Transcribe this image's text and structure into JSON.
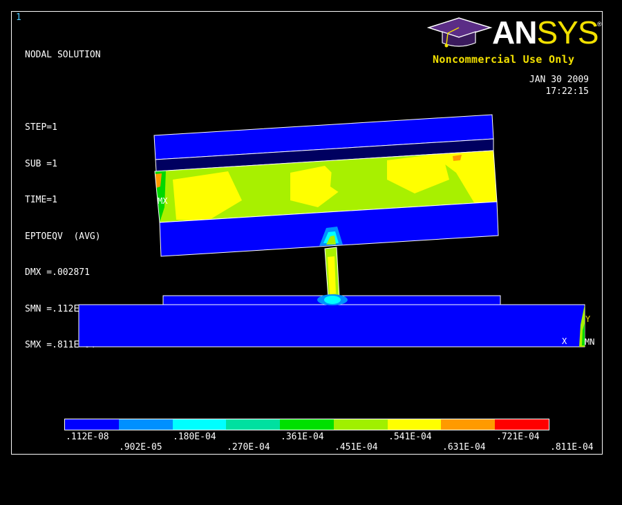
{
  "window_number": "1",
  "info_lines": [
    "NODAL SOLUTION",
    "",
    "STEP=1",
    "SUB =1",
    "TIME=1",
    "EPTOEQV  (AVG)",
    "DMX =.002871",
    "SMN =.112E-08",
    "SMX =.811E-04"
  ],
  "date": "JAN 30 2009",
  "time": "17:22:15",
  "logo": {
    "brand_a": "AN",
    "brand_b": "SYS",
    "registered": "®",
    "subtitle": "Noncommercial Use Only"
  },
  "markers": {
    "mx": "MX",
    "mn": "MN",
    "x_axis": "X",
    "y_axis": "Y"
  },
  "legend": {
    "colors": [
      "#0000ff",
      "#0090ff",
      "#00ffff",
      "#00e0a0",
      "#00e000",
      "#a0f000",
      "#ffff00",
      "#ff9a00",
      "#ff0000"
    ],
    "labels_top": [
      ".112E-08",
      ".180E-04",
      ".361E-04",
      ".541E-04",
      ".721E-04"
    ],
    "labels_bottom": [
      ".902E-05",
      ".270E-04",
      ".451E-04",
      ".631E-04",
      ".811E-04"
    ]
  },
  "colors": {
    "blue": "#0000ff",
    "navy": "#000060",
    "lime": "#a8f000",
    "yellow": "#ffff00",
    "green": "#00d800"
  }
}
